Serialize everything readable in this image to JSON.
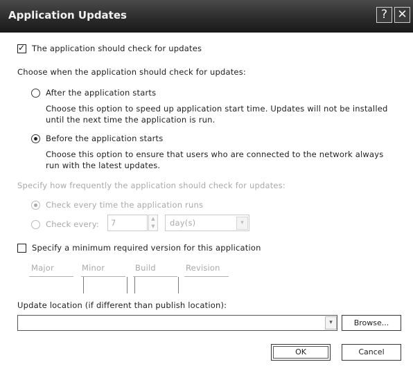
{
  "window": {
    "title": "Application Updates",
    "help_glyph": "?",
    "close_glyph": "✕"
  },
  "main": {
    "check_updates_label": "The application should check for updates",
    "choose_when_label": "Choose when the application should check for updates:",
    "after_starts": {
      "label": "After the application starts",
      "desc_line1": "Choose this option to speed up application start time. Updates will not be installed",
      "desc_line2": "until the next time the application is run."
    },
    "before_starts": {
      "label": "Before the application starts",
      "desc_line1": "Choose this option to ensure that users who are connected to the network always",
      "desc_line2": "run with the latest updates."
    },
    "frequency_label": "Specify how frequently the application should check for updates:",
    "check_every_time": "Check every time the application runs",
    "check_every_prefix": "Check every:",
    "interval_value": "7",
    "interval_unit": "day(s)",
    "min_version_label": "Specify a minimum required version for this application",
    "version_headers": [
      "Major",
      "Minor",
      "Build",
      "Revision"
    ],
    "update_location_label": "Update location (if different than publish location):",
    "update_location_value": "",
    "browse_label": "Browse...",
    "dropdown_glyph": "▾"
  },
  "footer": {
    "ok_label": "OK",
    "cancel_label": "Cancel"
  }
}
